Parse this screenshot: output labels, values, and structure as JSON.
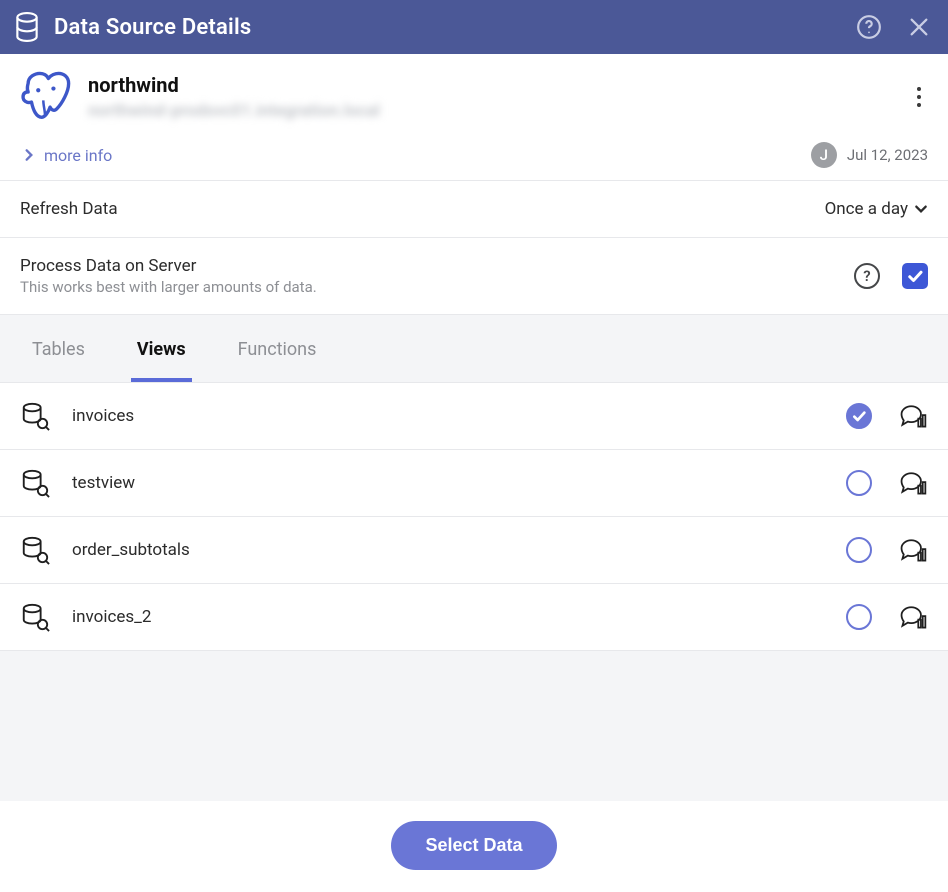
{
  "titlebar": {
    "title": "Data Source Details"
  },
  "datasource": {
    "name": "northwind",
    "subtitle": "northwind-prodsvc01.integration.local",
    "avatar_initial": "J",
    "date": "Jul 12, 2023",
    "more_info_label": "more info"
  },
  "settings": {
    "refresh_label": "Refresh Data",
    "refresh_value": "Once a day",
    "process_label": "Process Data on Server",
    "process_sub": "This works best with larger amounts of data.",
    "process_checked": true
  },
  "tabs": [
    {
      "key": "tables",
      "label": "Tables",
      "active": false
    },
    {
      "key": "views",
      "label": "Views",
      "active": true
    },
    {
      "key": "functions",
      "label": "Functions",
      "active": false
    }
  ],
  "views": [
    {
      "name": "invoices",
      "selected": true
    },
    {
      "name": "testview",
      "selected": false
    },
    {
      "name": "order_subtotals",
      "selected": false
    },
    {
      "name": "invoices_2",
      "selected": false
    }
  ],
  "footer": {
    "select_label": "Select Data"
  }
}
